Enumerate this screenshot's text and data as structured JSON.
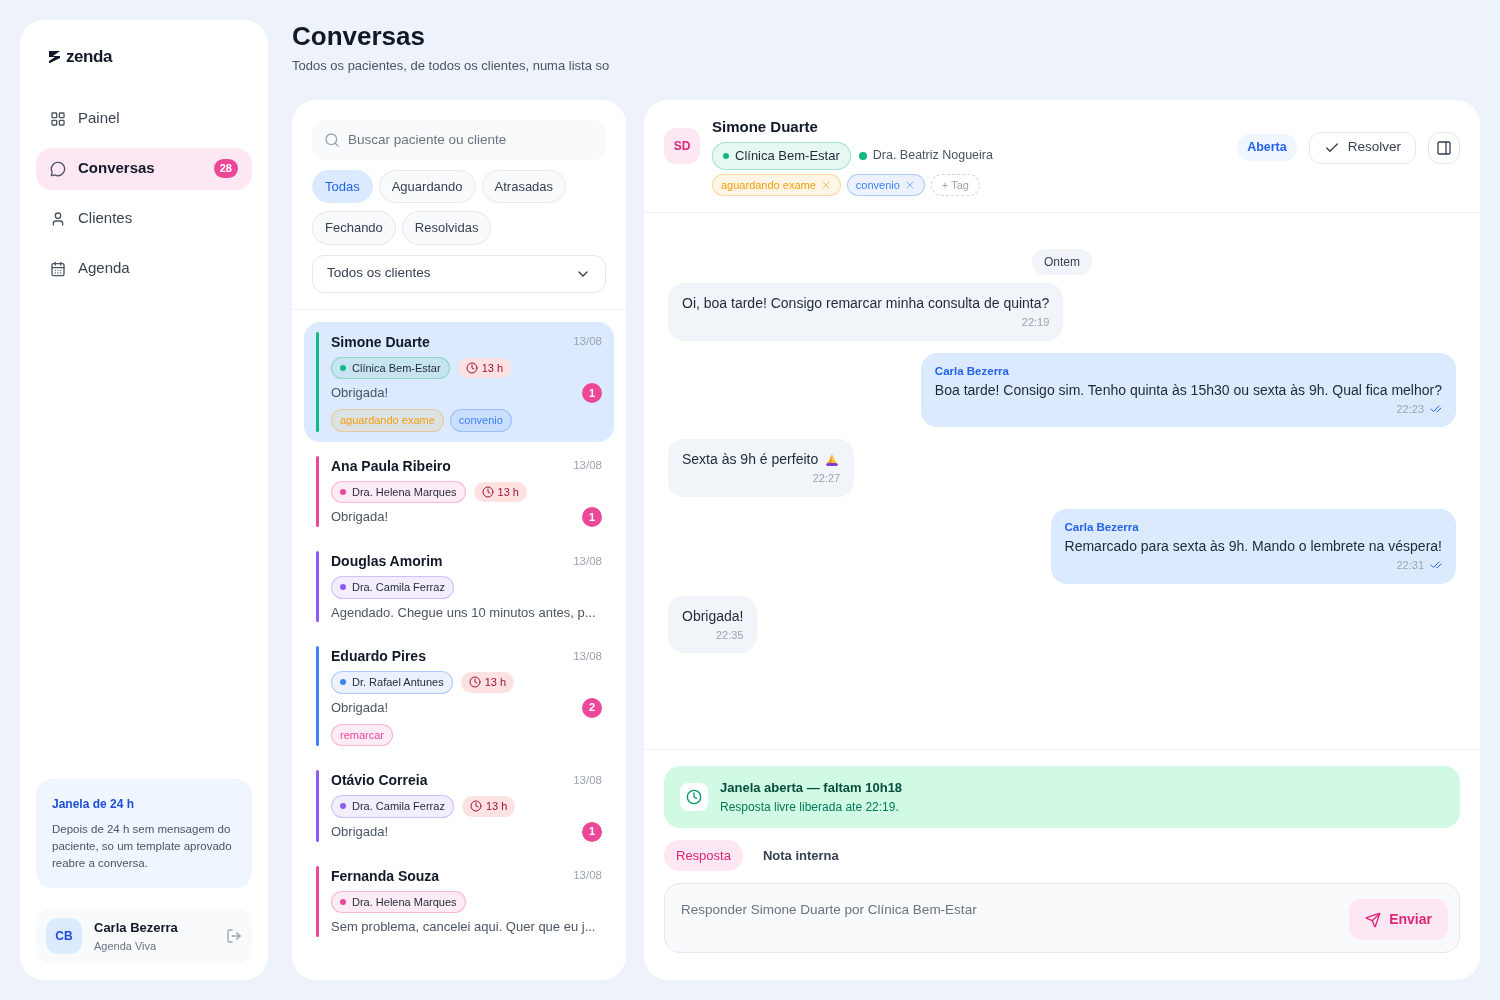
{
  "sidebar": {
    "logo": "zenda",
    "nav": [
      {
        "label": "Painel",
        "selected": false
      },
      {
        "label": "Conversas",
        "selected": true,
        "count": "28"
      },
      {
        "label": "Clientes",
        "selected": false
      },
      {
        "label": "Agenda",
        "selected": false
      }
    ],
    "info": {
      "title": "Janela de 24 h",
      "text": "Depois de 24 h sem mensagem do paciente, so um template aprovado reabre a conversa."
    },
    "user": {
      "initials": "CB",
      "name": "Carla Bezerra",
      "org": "Agenda Viva"
    }
  },
  "header": {
    "title": "Conversas",
    "subtitle": "Todos os pacientes, de todos os clientes, numa lista so"
  },
  "list": {
    "search": {
      "placeholder": "Buscar paciente ou cliente"
    },
    "filters": [
      {
        "label": "Todas",
        "selected": true
      },
      {
        "label": "Aguardando",
        "selected": false
      },
      {
        "label": "Atrasadas",
        "selected": false
      },
      {
        "label": "Fechando",
        "selected": false
      },
      {
        "label": "Resolvidas",
        "selected": false
      }
    ],
    "client_select": "Todos os clientes",
    "conversations": [
      {
        "name": "Simone Duarte",
        "date": "13/08",
        "owner": "Clínica Bem-Estar",
        "color": "#10b981",
        "timer": "13 h",
        "preview": "Obrigada!",
        "unread": "1",
        "selected": true,
        "tags": [
          {
            "label": "aguardando exame",
            "color": "#f59e0b"
          },
          {
            "label": "convenio",
            "color": "#3b82f6"
          }
        ]
      },
      {
        "name": "Ana Paula Ribeiro",
        "date": "13/08",
        "owner": "Dra. Helena Marques",
        "color": "#ec4899",
        "timer": "13 h",
        "preview": "Obrigada!",
        "unread": "1",
        "selected": false
      },
      {
        "name": "Douglas Amorim",
        "date": "13/08",
        "owner": "Dra. Camila Ferraz",
        "color": "#8b5cf6",
        "preview": "Agendado. Chegue uns 10 minutos antes, p...",
        "selected": false
      },
      {
        "name": "Eduardo Pires",
        "date": "13/08",
        "owner": "Dr. Rafael Antunes",
        "color": "#3b82f6",
        "timer": "13 h",
        "preview": "Obrigada!",
        "unread": "2",
        "selected": false,
        "tags": [
          {
            "label": "remarcar",
            "color": "#ec4899"
          }
        ]
      },
      {
        "name": "Otávio Correia",
        "date": "13/08",
        "owner": "Dra. Camila Ferraz",
        "color": "#8b5cf6",
        "timer": "13 h",
        "preview": "Obrigada!",
        "unread": "1",
        "selected": false
      },
      {
        "name": "Fernanda Souza",
        "date": "13/08",
        "owner": "Dra. Helena Marques",
        "color": "#ec4899",
        "preview": "Sem problema, cancelei aqui. Quer que eu j...",
        "selected": false
      }
    ]
  },
  "chat": {
    "initials": "SD",
    "name": "Simone Duarte",
    "client": "Clínica Bem-Estar",
    "doctor": "Dra. Beatriz Nogueira",
    "tags": [
      {
        "label": "aguardando exame",
        "color": "#f59e0b"
      },
      {
        "label": "convenio",
        "color": "#3b82f6"
      }
    ],
    "add_tag": "+ Tag",
    "status": "Aberta",
    "resolve": "Resolver",
    "day": "Ontem",
    "messages": [
      {
        "kind": "received",
        "text": "Oi, boa tarde! Consigo remarcar minha consulta de quinta?",
        "time": "22:19"
      },
      {
        "kind": "sent",
        "author": "Carla Bezerra",
        "text": "Boa tarde! Consigo sim. Tenho quinta às 15h30 ou sexta às 9h. Qual fica melhor?",
        "time": "22:23",
        "read": true
      },
      {
        "kind": "received",
        "text": "Sexta às 9h é perfeito",
        "emoji": true,
        "time": "22:27"
      },
      {
        "kind": "sent",
        "author": "Carla Bezerra",
        "text": "Remarcado para sexta às 9h. Mando o lembrete na véspera!",
        "time": "22:31",
        "read": true
      },
      {
        "kind": "received",
        "text": "Obrigada!",
        "time": "22:35"
      }
    ],
    "window_notice": {
      "title": "Janela aberta — faltam 10h18",
      "text": "Resposta livre liberada ate 22:19."
    },
    "modes": [
      {
        "label": "Resposta",
        "selected": true
      },
      {
        "label": "Nota interna",
        "selected": false
      }
    ],
    "composer": {
      "placeholder": "Responder Simone Duarte por Clínica Bem-Estar",
      "send": "Enviar"
    }
  }
}
